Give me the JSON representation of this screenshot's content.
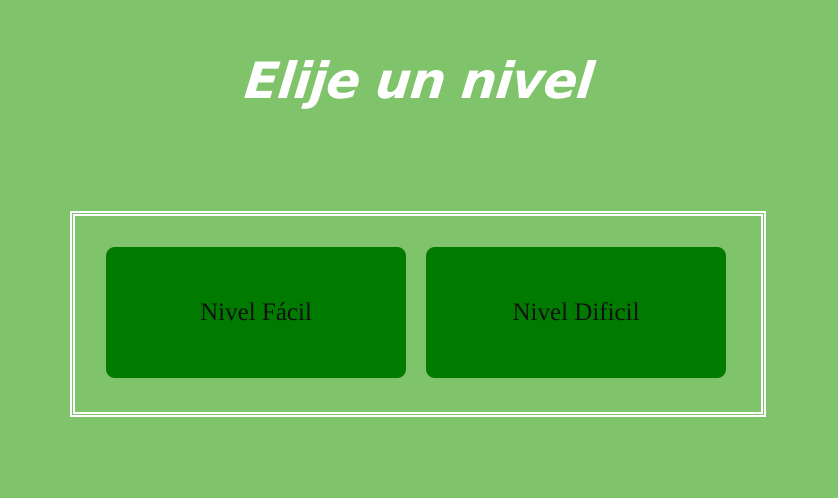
{
  "header": {
    "title": "Elije un nivel"
  },
  "levels": [
    {
      "label": "Nivel Fácil"
    },
    {
      "label": "Nivel Dificil"
    }
  ],
  "colors": {
    "background": "#7fc36a",
    "button": "#007b00",
    "title_text": "#ffffff",
    "button_text": "#111111",
    "frame_border": "#ffffff"
  }
}
